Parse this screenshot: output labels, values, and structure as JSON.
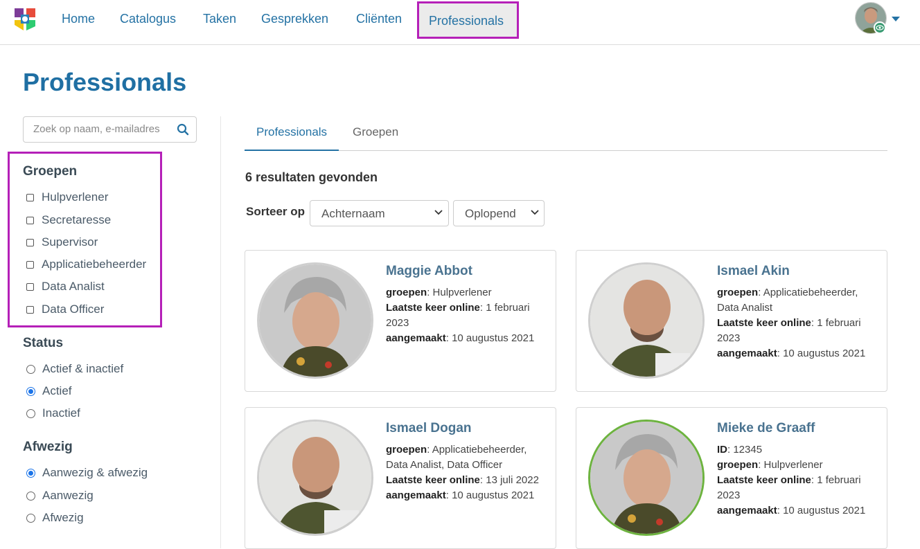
{
  "nav": {
    "items": [
      "Home",
      "Catalogus",
      "Taken",
      "Gesprekken",
      "Cliënten",
      "Professionals"
    ],
    "active": "Professionals"
  },
  "page": {
    "title": "Professionals"
  },
  "search": {
    "placeholder": "Zoek op naam, e-mailadres"
  },
  "filters": {
    "groups": {
      "heading": "Groepen",
      "options": [
        "Hulpverlener",
        "Secretaresse",
        "Supervisor",
        "Applicatiebeheerder",
        "Data Analist",
        "Data Officer"
      ]
    },
    "status": {
      "heading": "Status",
      "options": [
        "Actief & inactief",
        "Actief",
        "Inactief"
      ],
      "selected": "Actief"
    },
    "absent": {
      "heading": "Afwezig",
      "options": [
        "Aanwezig & afwezig",
        "Aanwezig",
        "Afwezig"
      ],
      "selected": "Aanwezig & afwezig"
    }
  },
  "tabs": [
    "Professionals",
    "Groepen"
  ],
  "results": {
    "text": "6 resultaten gevonden"
  },
  "sort": {
    "label": "Sorteer op",
    "field": "Achternaam",
    "order": "Oplopend"
  },
  "labels": {
    "groups": "groepen",
    "last_online": "Laatste keer online",
    "created": "aangemaakt",
    "id": "ID"
  },
  "professionals": [
    {
      "name": "Maggie Abbot",
      "groups": "Hulpverlener",
      "last_online": "1 februari 2023",
      "created": "10 augustus 2021"
    },
    {
      "name": "Ismael Akin",
      "groups": "Applicatiebeheerder, Data Analist",
      "last_online": "1 februari 2023",
      "created": "10 augustus 2021"
    },
    {
      "name": "Ismael Dogan",
      "groups": "Applicatiebeheerder, Data Analist, Data Officer",
      "last_online": "13 juli 2022",
      "created": "10 augustus 2021"
    },
    {
      "name": "Mieke de Graaff",
      "id": "12345",
      "groups": "Hulpverlener",
      "last_online": "1 februari 2023",
      "created": "10 augustus 2021"
    }
  ],
  "colors": {
    "brand": "#1f6fa3",
    "highlight": "#b520b8",
    "online": "#6db33f"
  },
  "icons": {
    "search": "search-icon",
    "user_menu": "chevron-down-icon",
    "viewing": "eye-icon"
  }
}
